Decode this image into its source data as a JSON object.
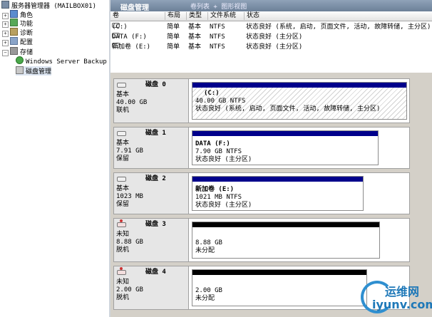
{
  "tree": {
    "root": "服务器管理器 (MAILBOX01)",
    "items": [
      {
        "label": "角色"
      },
      {
        "label": "功能"
      },
      {
        "label": "诊断"
      },
      {
        "label": "配置"
      },
      {
        "label": "存储"
      },
      {
        "label": "Windows Server Backup"
      },
      {
        "label": "磁盘管理"
      }
    ]
  },
  "header": {
    "title": "磁盘管理",
    "view": "卷列表 + 图形视图"
  },
  "columns": [
    "卷",
    "布局",
    "类型",
    "文件系统",
    "状态"
  ],
  "volumes": [
    {
      "name": "(C:)",
      "layout": "简单",
      "type": "基本",
      "fs": "NTFS",
      "status": "状态良好 (系统, 启动, 页面文件, 活动, 故障转储, 主分区)"
    },
    {
      "name": "DATA (F:)",
      "layout": "简单",
      "type": "基本",
      "fs": "NTFS",
      "status": "状态良好 (主分区)"
    },
    {
      "name": "新加卷 (E:)",
      "layout": "简单",
      "type": "基本",
      "fs": "NTFS",
      "status": "状态良好 (主分区)"
    }
  ],
  "disks": [
    {
      "name": "磁盘 0",
      "kind": "基本",
      "size": "40.00 GB",
      "state": "联机",
      "part": {
        "label": "(C:)",
        "size": "40.00 GB NTFS",
        "status": "状态良好 (系统, 启动, 页面文件, 活动, 故障转储, 主分区)",
        "capacity_gb": 40.0
      }
    },
    {
      "name": "磁盘 1",
      "kind": "基本",
      "size": "7.91 GB",
      "state": "保留",
      "part": {
        "label": "DATA  (F:)",
        "size": "7.90 GB NTFS",
        "status": "状态良好 (主分区)",
        "capacity_gb": 7.9
      }
    },
    {
      "name": "磁盘 2",
      "kind": "基本",
      "size": "1023 MB",
      "state": "保留",
      "part": {
        "label": "新加卷  (E:)",
        "size": "1021 MB NTFS",
        "status": "状态良好 (主分区)",
        "capacity_gb": 1.0
      }
    },
    {
      "name": "磁盘 3",
      "kind": "未知",
      "size": "8.88 GB",
      "state": "脱机",
      "part": {
        "label": "",
        "size": "8.88 GB",
        "status": "未分配",
        "capacity_gb": 8.88
      }
    },
    {
      "name": "磁盘 4",
      "kind": "未知",
      "size": "2.00 GB",
      "state": "脱机",
      "part": {
        "label": "",
        "size": "2.00 GB",
        "status": "未分配",
        "capacity_gb": 2.0
      }
    }
  ],
  "colors": {
    "primary": "#00008b",
    "unallocated": "#000000"
  },
  "watermark": {
    "line1": "运维网",
    "line2": "iyunv.com"
  }
}
